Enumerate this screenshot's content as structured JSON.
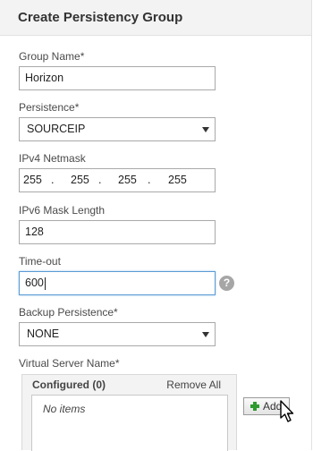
{
  "dialog": {
    "title": "Create Persistency Group"
  },
  "fields": {
    "group_name": {
      "label": "Group Name*",
      "value": "Horizon"
    },
    "persistence": {
      "label": "Persistence*",
      "value": "SOURCEIP"
    },
    "ipv4_netmask": {
      "label": "IPv4 Netmask",
      "octets": [
        "255",
        "255",
        "255",
        "255"
      ],
      "separator": "."
    },
    "ipv6_mask_length": {
      "label": "IPv6 Mask Length",
      "value": "128"
    },
    "timeout": {
      "label": "Time-out",
      "value": "600"
    },
    "backup_persistence": {
      "label": "Backup Persistence*",
      "value": "NONE"
    }
  },
  "virtual_server": {
    "label": "Virtual Server Name*",
    "configured_label": "Configured (0)",
    "remove_all_label": "Remove All",
    "empty_text": "No items",
    "add_label": "Add"
  },
  "icons": {
    "help": "help-icon",
    "add": "plus-icon",
    "cursor": "mouse-pointer-icon"
  },
  "colors": {
    "focus_border": "#5b9bd5",
    "add_icon": "#2e9b2e"
  }
}
